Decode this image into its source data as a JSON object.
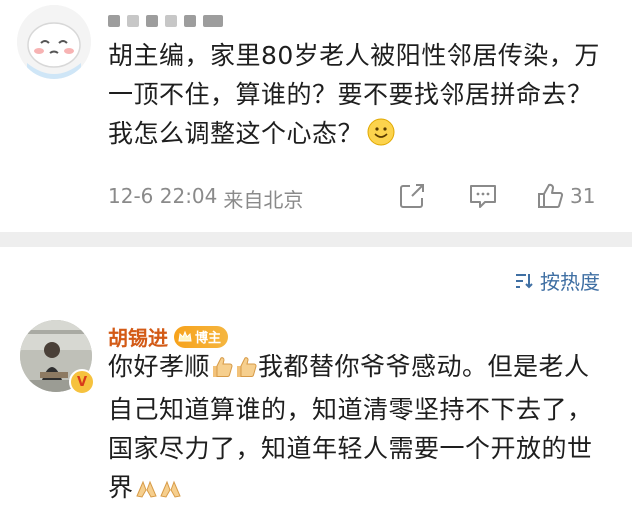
{
  "post": {
    "text": "胡主编，家里80岁老人被阳性邻居传染，万一顶不住，算谁的？要不要找邻居拼命去？我怎么调整这个心态？",
    "date": "12-6 22:04",
    "location": "来自北京",
    "like_count": "31"
  },
  "sort": {
    "label": "按热度"
  },
  "reply": {
    "author": "胡锡进",
    "badge": "博主",
    "text_a": "你好孝顺",
    "text_b": "我都替你爷爷感动。但是老人自己知道算谁的，知道清零坚持不下去了，国家尽力了，知道年轻人需要一个开放的世界"
  },
  "colors": {
    "username": "#d35a16",
    "link": "#3f6fa3",
    "meta": "#8a8a8a",
    "divider": "#eeeeee"
  }
}
